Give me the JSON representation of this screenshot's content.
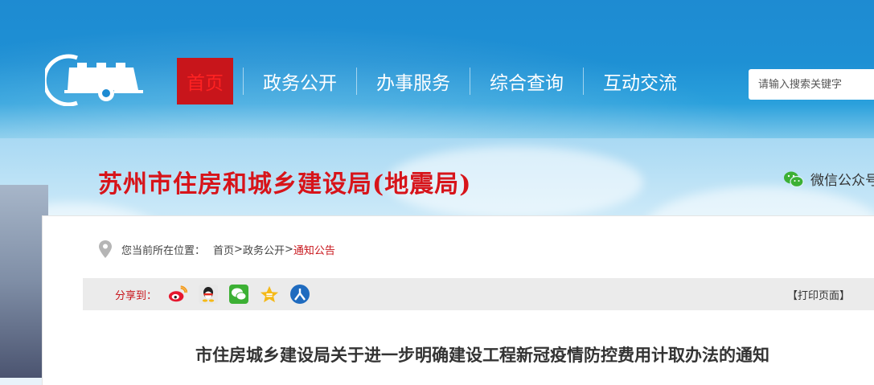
{
  "nav": {
    "items": [
      {
        "label": "首页",
        "active": true
      },
      {
        "label": "政务公开"
      },
      {
        "label": "办事服务"
      },
      {
        "label": "综合查询"
      },
      {
        "label": "互动交流"
      }
    ]
  },
  "search": {
    "placeholder": "请输入搜索关键字"
  },
  "site": {
    "title": "苏州市住房和城乡建设局(地震局)"
  },
  "wechat": {
    "label": "微信公众号"
  },
  "breadcrumb": {
    "prefix": "您当前所在位置：",
    "home": "首页",
    "sep1": ">",
    "section": "政务公开",
    "sep2": ">",
    "current": "通知公告"
  },
  "share": {
    "label": "分享到：",
    "icons": [
      "weibo-icon",
      "qq-icon",
      "wechat-icon",
      "qzone-icon",
      "renren-icon"
    ],
    "print_label": "【打印页面】"
  },
  "article": {
    "title": "市住房城乡建设局关于进一步明确建设工程新冠疫情防控费用计取办法的通知"
  },
  "colors": {
    "brand_red": "#c8151b",
    "nav_blue": "#1e8bd2"
  }
}
